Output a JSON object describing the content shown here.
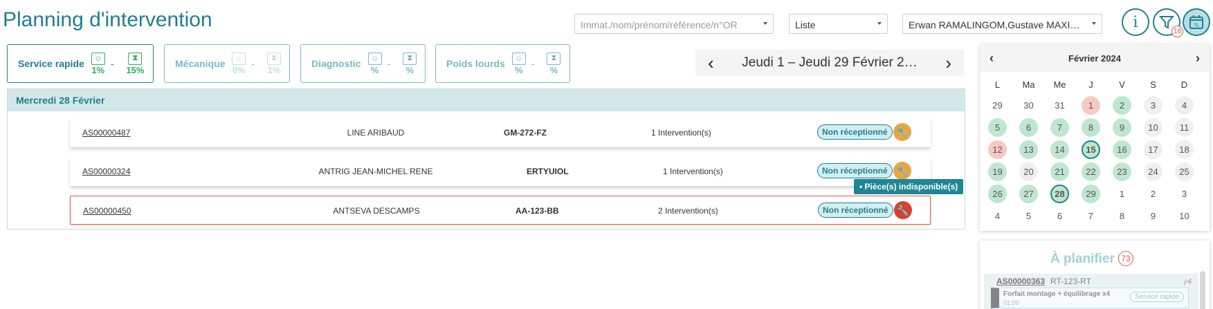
{
  "header": {
    "title": "Planning d'intervention",
    "search_placeholder": "Immat./nom/prénom/référence/n°OR",
    "view_select": "Liste",
    "technicians_select": "Erwan RAMALINGOM,Gustave MAXI…",
    "filter_count": "18"
  },
  "services": [
    {
      "label": "Service rapide",
      "left_pct": "1%",
      "right_pct": "15%"
    },
    {
      "label": "Mécanique",
      "left_pct": "0%",
      "right_pct": "1%"
    },
    {
      "label": "Diagnostic",
      "left_pct": "%",
      "right_pct": "%"
    },
    {
      "label": "Poids lourds",
      "left_pct": "%",
      "right_pct": "%"
    }
  ],
  "date_range": "Jeudi 1 – Jeudi 29 Février 2…",
  "day": {
    "header": "Mercredi 28 Février",
    "rows": [
      {
        "ref": "AS00000487",
        "name": "LINE ARIBAUD",
        "plate": "GM-272-FZ",
        "interventions": "1 Intervention(s)",
        "status": "Non réceptionné"
      },
      {
        "ref": "AS00000324",
        "name": "ANTRIG JEAN-MICHEL RENE",
        "plate": "ERTYUIOL",
        "interventions": "1 Intervention(s)",
        "status": "Non réceptionné"
      },
      {
        "ref": "AS00000450",
        "name": "ANTSEVA DESCAMPS",
        "plate": "AA-123-BB",
        "interventions": "2 Intervention(s)",
        "status": "Non réceptionné"
      }
    ],
    "tooltip": "Pièce(s) indisponible(s)"
  },
  "calendar": {
    "month": "Février 2024",
    "weekdays": [
      "L",
      "Ma",
      "Me",
      "J",
      "V",
      "S",
      "D"
    ],
    "days": [
      {
        "n": "29",
        "s": "o"
      },
      {
        "n": "30",
        "s": "o"
      },
      {
        "n": "31",
        "s": "o"
      },
      {
        "n": "1",
        "s": "r"
      },
      {
        "n": "2",
        "s": "g"
      },
      {
        "n": "3",
        "s": "lg"
      },
      {
        "n": "4",
        "s": "lg"
      },
      {
        "n": "5",
        "s": "g"
      },
      {
        "n": "6",
        "s": "g"
      },
      {
        "n": "7",
        "s": "g"
      },
      {
        "n": "8",
        "s": "g"
      },
      {
        "n": "9",
        "s": "g"
      },
      {
        "n": "10",
        "s": "lg"
      },
      {
        "n": "11",
        "s": "lg"
      },
      {
        "n": "12",
        "s": "r"
      },
      {
        "n": "13",
        "s": "g"
      },
      {
        "n": "14",
        "s": "g"
      },
      {
        "n": "15",
        "s": "sel"
      },
      {
        "n": "16",
        "s": "g"
      },
      {
        "n": "17",
        "s": "lg"
      },
      {
        "n": "18",
        "s": "lg"
      },
      {
        "n": "19",
        "s": "g"
      },
      {
        "n": "20",
        "s": "lg"
      },
      {
        "n": "21",
        "s": "g"
      },
      {
        "n": "22",
        "s": "g"
      },
      {
        "n": "23",
        "s": "g"
      },
      {
        "n": "24",
        "s": "lg"
      },
      {
        "n": "25",
        "s": "lg"
      },
      {
        "n": "26",
        "s": "g"
      },
      {
        "n": "27",
        "s": "g"
      },
      {
        "n": "28",
        "s": "sel"
      },
      {
        "n": "29",
        "s": "g"
      },
      {
        "n": "1",
        "s": "muted"
      },
      {
        "n": "2",
        "s": "muted"
      },
      {
        "n": "3",
        "s": "muted"
      },
      {
        "n": "4",
        "s": "muted"
      },
      {
        "n": "5",
        "s": "muted"
      },
      {
        "n": "6",
        "s": "muted"
      },
      {
        "n": "7",
        "s": "muted"
      },
      {
        "n": "8",
        "s": "muted"
      },
      {
        "n": "9",
        "s": "muted"
      },
      {
        "n": "10",
        "s": "muted"
      }
    ]
  },
  "planifier": {
    "title": "À planifier",
    "count": "73",
    "card": {
      "ref": "AS00000363",
      "plate": "RT-123-RT",
      "delay": "j-6",
      "task": "Forfait montage + équilibrage x4",
      "duration": "01:00",
      "service": "Service rapide"
    }
  },
  "colors": {
    "brand": "#1f7f8c",
    "ok": "#2bae5f",
    "alert": "#d9412f",
    "warning": "#e5a843"
  }
}
